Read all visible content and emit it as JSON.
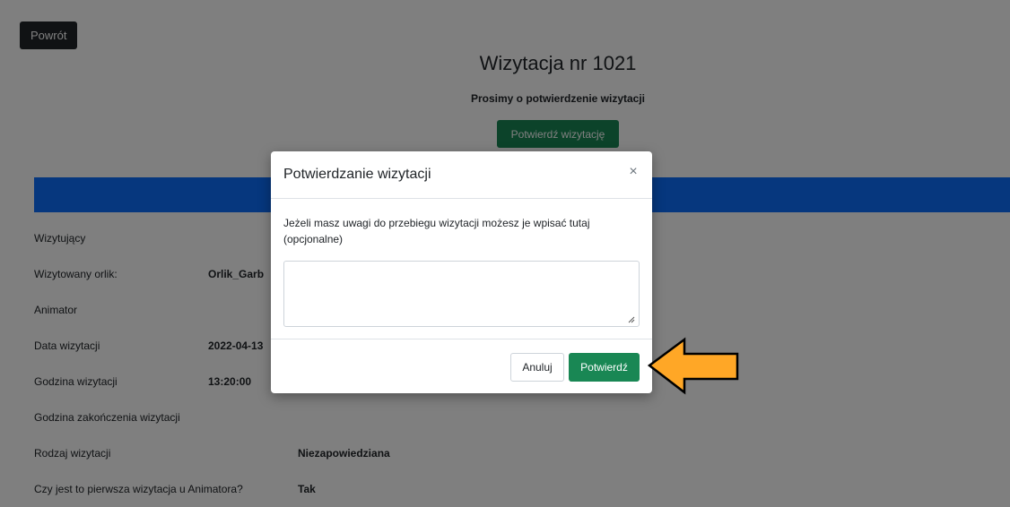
{
  "header": {
    "back_label": "Powrót",
    "title": "Wizytacja nr 1021",
    "subtitle": "Prosimy o potwierdzenie wizytacji",
    "confirm_visit_label": "Potwierdź wizytację"
  },
  "details": [
    {
      "label": "Wizytujący",
      "value": ""
    },
    {
      "label": "Wizytowany orlik:",
      "value": "Orlik_Garb"
    },
    {
      "label": "Animator",
      "value": ""
    },
    {
      "label": "Data wizytacji",
      "value": "2022-04-13"
    },
    {
      "label": "Godzina wizytacji",
      "value": "13:20:00"
    },
    {
      "label": "Godzina zakończenia wizytacji",
      "value": ""
    },
    {
      "label": "Rodzaj wizytacji",
      "value": "Niezapowiedziana"
    },
    {
      "label": "Czy jest to pierwsza wizytacja u Animatora?",
      "value": "Tak"
    }
  ],
  "modal": {
    "title": "Potwierdzanie wizytacji",
    "close_symbol": "×",
    "text": "Jeżeli masz uwagi do przebiegu wizytacji możesz je wpisać tutaj (opcjonalne)",
    "remarks_value": "",
    "cancel_label": "Anuluj",
    "confirm_label": "Potwierdź"
  },
  "colors": {
    "primary_blue": "#0d6efd",
    "success_green": "#198754",
    "dark_button": "#212529",
    "arrow_fill": "#ffa726"
  },
  "icons": {
    "close": "close-icon",
    "pointer": "arrow-left-icon"
  }
}
